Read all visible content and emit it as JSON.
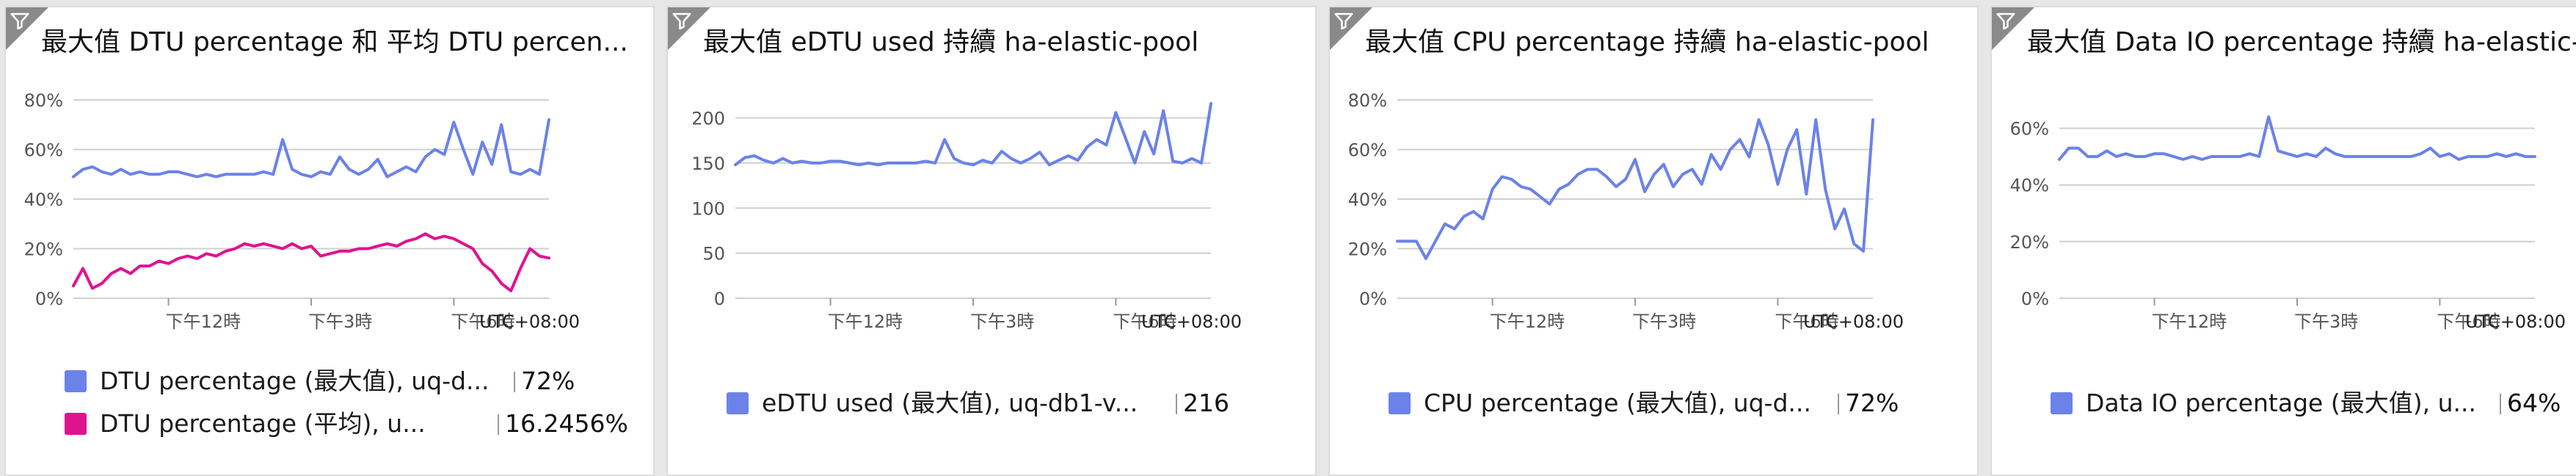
{
  "colors": {
    "blue": "#6b82e8",
    "pink": "#e0138f",
    "grid": "#d0d0d0",
    "axis_text": "#555555"
  },
  "tiles": [
    {
      "title": "最大值 DTU percentage 和 平均 DTU percen...",
      "legend": [
        {
          "label": "DTU percentage (最大值), uq-d...",
          "value": "72%",
          "color": "#6b82e8"
        },
        {
          "label": "DTU percentage (平均), u...",
          "value": "16.2456%",
          "color": "#e0138f"
        }
      ]
    },
    {
      "title": "最大值 eDTU used 持續 ha-elastic-pool",
      "legend": [
        {
          "label": "eDTU used (最大值), uq-db1-v...",
          "value": "216",
          "color": "#6b82e8"
        }
      ]
    },
    {
      "title": "最大值 CPU percentage 持續 ha-elastic-pool",
      "legend": [
        {
          "label": "CPU percentage (最大值), uq-d...",
          "value": "72%",
          "color": "#6b82e8"
        }
      ]
    },
    {
      "title": "最大值 Data IO percentage 持續 ha-elastic-...",
      "legend": [
        {
          "label": "Data IO percentage (最大值), u...",
          "value": "64%",
          "color": "#6b82e8"
        }
      ]
    }
  ],
  "chart_data": [
    {
      "type": "line",
      "timezone_label": "UTC+08:00",
      "ylim": [
        0,
        80
      ],
      "yticks": [
        0,
        20,
        40,
        60,
        80
      ],
      "ytick_labels": [
        "0%",
        "20%",
        "40%",
        "60%",
        "80%"
      ],
      "xlim": [
        10.0,
        20.0
      ],
      "xticks": [
        12,
        15,
        18
      ],
      "xtick_labels": [
        "下午12時",
        "下午3時",
        "下午6時"
      ],
      "series": [
        {
          "name": "DTU percentage (最大值), uq-d...",
          "color": "#6b82e8",
          "x": [
            10.0,
            10.2,
            10.4,
            10.6,
            10.8,
            11.0,
            11.2,
            11.4,
            11.6,
            11.8,
            12.0,
            12.2,
            12.4,
            12.6,
            12.8,
            13.0,
            13.2,
            13.4,
            13.6,
            13.8,
            14.0,
            14.2,
            14.4,
            14.6,
            14.8,
            15.0,
            15.2,
            15.4,
            15.6,
            15.8,
            16.0,
            16.2,
            16.4,
            16.6,
            16.8,
            17.0,
            17.2,
            17.4,
            17.6,
            17.8,
            18.0,
            18.2,
            18.4,
            18.6,
            18.8,
            19.0,
            19.2,
            19.4,
            19.6,
            19.8,
            20.0
          ],
          "y": [
            49,
            52,
            53,
            51,
            50,
            52,
            50,
            51,
            50,
            50,
            51,
            51,
            50,
            49,
            50,
            49,
            50,
            50,
            50,
            50,
            51,
            50,
            64,
            52,
            50,
            49,
            51,
            50,
            57,
            52,
            50,
            52,
            56,
            49,
            51,
            53,
            51,
            57,
            60,
            58,
            71,
            60,
            50,
            63,
            54,
            70,
            51,
            50,
            52,
            50,
            72
          ]
        },
        {
          "name": "DTU percentage (平均), u...",
          "color": "#e0138f",
          "x": [
            10.0,
            10.2,
            10.4,
            10.6,
            10.8,
            11.0,
            11.2,
            11.4,
            11.6,
            11.8,
            12.0,
            12.2,
            12.4,
            12.6,
            12.8,
            13.0,
            13.2,
            13.4,
            13.6,
            13.8,
            14.0,
            14.2,
            14.4,
            14.6,
            14.8,
            15.0,
            15.2,
            15.4,
            15.6,
            15.8,
            16.0,
            16.2,
            16.4,
            16.6,
            16.8,
            17.0,
            17.2,
            17.4,
            17.6,
            17.8,
            18.0,
            18.2,
            18.4,
            18.6,
            18.8,
            19.0,
            19.2,
            19.4,
            19.6,
            19.8,
            20.0
          ],
          "y": [
            5,
            12,
            4,
            6,
            10,
            12,
            10,
            13,
            13,
            15,
            14,
            16,
            17,
            16,
            18,
            17,
            19,
            20,
            22,
            21,
            22,
            21,
            20,
            22,
            20,
            21,
            17,
            18,
            19,
            19,
            20,
            20,
            21,
            22,
            21,
            23,
            24,
            26,
            24,
            25,
            24,
            22,
            20,
            14,
            11,
            6,
            3,
            12,
            20,
            17,
            16.2
          ]
        }
      ]
    },
    {
      "type": "line",
      "timezone_label": "UTC+08:00",
      "ylim": [
        0,
        220
      ],
      "yticks": [
        0,
        50,
        100,
        150,
        200
      ],
      "ytick_labels": [
        "0",
        "50",
        "100",
        "150",
        "200"
      ],
      "xlim": [
        10.0,
        20.0
      ],
      "xticks": [
        12,
        15,
        18
      ],
      "xtick_labels": [
        "下午12時",
        "下午3時",
        "下午6時"
      ],
      "series": [
        {
          "name": "eDTU used (最大值), uq-db1-v...",
          "color": "#6b82e8",
          "x": [
            10.0,
            10.2,
            10.4,
            10.6,
            10.8,
            11.0,
            11.2,
            11.4,
            11.6,
            11.8,
            12.0,
            12.2,
            12.4,
            12.6,
            12.8,
            13.0,
            13.2,
            13.4,
            13.6,
            13.8,
            14.0,
            14.2,
            14.4,
            14.6,
            14.8,
            15.0,
            15.2,
            15.4,
            15.6,
            15.8,
            16.0,
            16.2,
            16.4,
            16.6,
            16.8,
            17.0,
            17.2,
            17.4,
            17.6,
            17.8,
            18.0,
            18.2,
            18.4,
            18.6,
            18.8,
            19.0,
            19.2,
            19.4,
            19.6,
            19.8,
            20.0
          ],
          "y": [
            148,
            156,
            158,
            153,
            150,
            155,
            150,
            152,
            150,
            150,
            152,
            152,
            150,
            148,
            150,
            148,
            150,
            150,
            150,
            150,
            152,
            150,
            176,
            155,
            150,
            148,
            153,
            150,
            163,
            155,
            150,
            155,
            162,
            148,
            153,
            158,
            153,
            168,
            176,
            170,
            206,
            178,
            150,
            185,
            160,
            208,
            152,
            150,
            155,
            150,
            216
          ]
        }
      ]
    },
    {
      "type": "line",
      "timezone_label": "UTC+08:00",
      "ylim": [
        0,
        80
      ],
      "yticks": [
        0,
        20,
        40,
        60,
        80
      ],
      "ytick_labels": [
        "0%",
        "20%",
        "40%",
        "60%",
        "80%"
      ],
      "xlim": [
        10.0,
        20.0
      ],
      "xticks": [
        12,
        15,
        18
      ],
      "xtick_labels": [
        "下午12時",
        "下午3時",
        "下午6時"
      ],
      "series": [
        {
          "name": "CPU percentage (最大值), uq-d...",
          "color": "#6b82e8",
          "x": [
            10.0,
            10.2,
            10.4,
            10.6,
            10.8,
            11.0,
            11.2,
            11.4,
            11.6,
            11.8,
            12.0,
            12.2,
            12.4,
            12.6,
            12.8,
            13.0,
            13.2,
            13.4,
            13.6,
            13.8,
            14.0,
            14.2,
            14.4,
            14.6,
            14.8,
            15.0,
            15.2,
            15.4,
            15.6,
            15.8,
            16.0,
            16.2,
            16.4,
            16.6,
            16.8,
            17.0,
            17.2,
            17.4,
            17.6,
            17.8,
            18.0,
            18.2,
            18.4,
            18.6,
            18.8,
            19.0,
            19.2,
            19.4,
            19.6,
            19.8,
            20.0
          ],
          "y": [
            23,
            23,
            23,
            16,
            23,
            30,
            28,
            33,
            35,
            32,
            44,
            49,
            48,
            45,
            44,
            41,
            38,
            44,
            46,
            50,
            52,
            52,
            49,
            45,
            48,
            56,
            43,
            50,
            54,
            45,
            50,
            52,
            46,
            58,
            52,
            60,
            64,
            57,
            72,
            62,
            46,
            60,
            68,
            42,
            72,
            44,
            28,
            36,
            22,
            19,
            72
          ]
        }
      ]
    },
    {
      "type": "line",
      "timezone_label": "UTC+08:00",
      "ylim": [
        0,
        70
      ],
      "yticks": [
        0,
        20,
        40,
        60
      ],
      "ytick_labels": [
        "0%",
        "20%",
        "40%",
        "60%"
      ],
      "xlim": [
        10.0,
        20.0
      ],
      "xticks": [
        12,
        15,
        18
      ],
      "xtick_labels": [
        "下午12時",
        "下午3時",
        "下午6時"
      ],
      "series": [
        {
          "name": "Data IO percentage (最大值), u...",
          "color": "#6b82e8",
          "x": [
            10.0,
            10.2,
            10.4,
            10.6,
            10.8,
            11.0,
            11.2,
            11.4,
            11.6,
            11.8,
            12.0,
            12.2,
            12.4,
            12.6,
            12.8,
            13.0,
            13.2,
            13.4,
            13.6,
            13.8,
            14.0,
            14.2,
            14.4,
            14.6,
            14.8,
            15.0,
            15.2,
            15.4,
            15.6,
            15.8,
            16.0,
            16.2,
            16.4,
            16.6,
            16.8,
            17.0,
            17.2,
            17.4,
            17.6,
            17.8,
            18.0,
            18.2,
            18.4,
            18.6,
            18.8,
            19.0,
            19.2,
            19.4,
            19.6,
            19.8,
            20.0
          ],
          "y": [
            49,
            53,
            53,
            50,
            50,
            52,
            50,
            51,
            50,
            50,
            51,
            51,
            50,
            49,
            50,
            49,
            50,
            50,
            50,
            50,
            51,
            50,
            64,
            52,
            51,
            50,
            51,
            50,
            53,
            51,
            50,
            50,
            50,
            50,
            50,
            50,
            50,
            50,
            51,
            53,
            50,
            51,
            49,
            50,
            50,
            50,
            51,
            50,
            51,
            50,
            50
          ]
        }
      ]
    }
  ]
}
